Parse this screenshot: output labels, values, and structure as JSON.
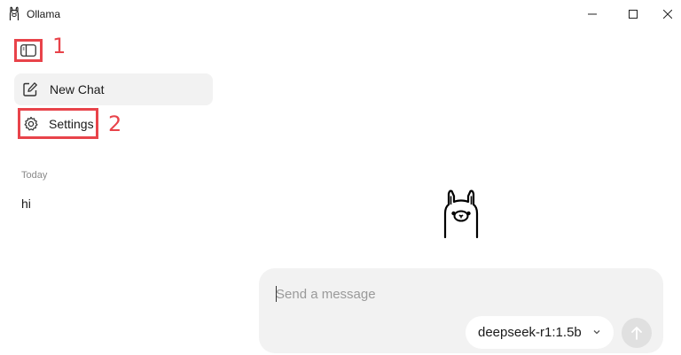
{
  "window": {
    "title": "Ollama"
  },
  "annotations": {
    "one": "1",
    "two": "2"
  },
  "sidebar": {
    "new_chat_label": "New Chat",
    "settings_label": "Settings",
    "section_today": "Today",
    "chats": [
      "hi"
    ]
  },
  "composer": {
    "placeholder": "Send a message",
    "model": "deepseek-r1:1.5b"
  },
  "icons": {
    "app": "llama-logo-icon",
    "minimize": "minimize-icon",
    "maximize": "maximize-icon",
    "close": "close-icon",
    "sidebar_toggle": "sidebar-toggle-icon",
    "new_chat": "edit-icon",
    "settings": "gear-icon",
    "model_chevron": "chevron-down-icon",
    "send": "arrow-up-icon"
  },
  "colors": {
    "annotation": "#e8434a",
    "composer_bg": "#f2f2f2",
    "active_item_bg": "#f2f2f2",
    "send_disabled": "#e0e0e0"
  }
}
